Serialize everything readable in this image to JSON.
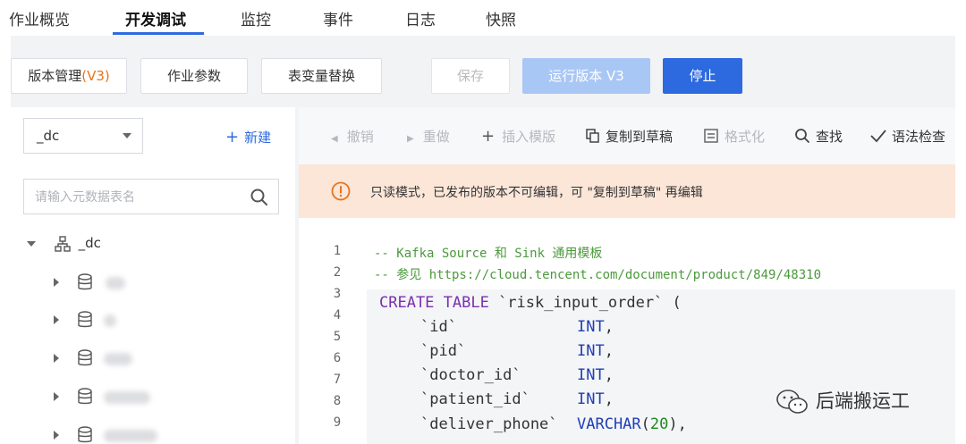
{
  "tabs": [
    "作业概览",
    "开发调试",
    "监控",
    "事件",
    "日志",
    "快照"
  ],
  "toolbar": {
    "version_manage": "版本管理",
    "version_tag": "(V3)",
    "job_params": "作业参数",
    "var_replace": "表变量替换",
    "save": "保存",
    "run_version": "运行版本 V3",
    "stop": "停止"
  },
  "left_panel": {
    "select_value": "_dc",
    "new_label": "新建",
    "search_placeholder": "请输入元数据表名",
    "tree_root": "_dc"
  },
  "editor_toolbar": {
    "undo": "撤销",
    "redo": "重做",
    "insert_template": "插入模版",
    "copy_to_draft": "复制到草稿",
    "format": "格式化",
    "find": "查找",
    "syntax_check": "语法检查"
  },
  "notice": "只读模式，已发布的版本不可编辑，可 \"复制到草稿\" 再编辑",
  "code": {
    "line_numbers": [
      "1",
      "2",
      "3",
      "4",
      "5",
      "6",
      "7",
      "8",
      "9"
    ],
    "comment1": "-- Kafka Source 和 Sink 通用模板",
    "comment2": "-- 参见 https://cloud.tencent.com/document/product/849/48310",
    "create_kw": "CREATE TABLE",
    "table_name": " `risk_input_order` (",
    "fields": [
      {
        "name": "`id`",
        "type": "INT",
        "suffix": ","
      },
      {
        "name": "`pid`",
        "type": "INT",
        "suffix": ","
      },
      {
        "name": "`doctor_id`",
        "type": "INT",
        "suffix": ","
      },
      {
        "name": "`patient_id`",
        "type": "INT",
        "suffix": ","
      },
      {
        "name": "`deliver_phone`",
        "type": "VARCHAR",
        "arg": "20",
        "suffix": "),"
      }
    ]
  },
  "watermark": "后端搬运工"
}
